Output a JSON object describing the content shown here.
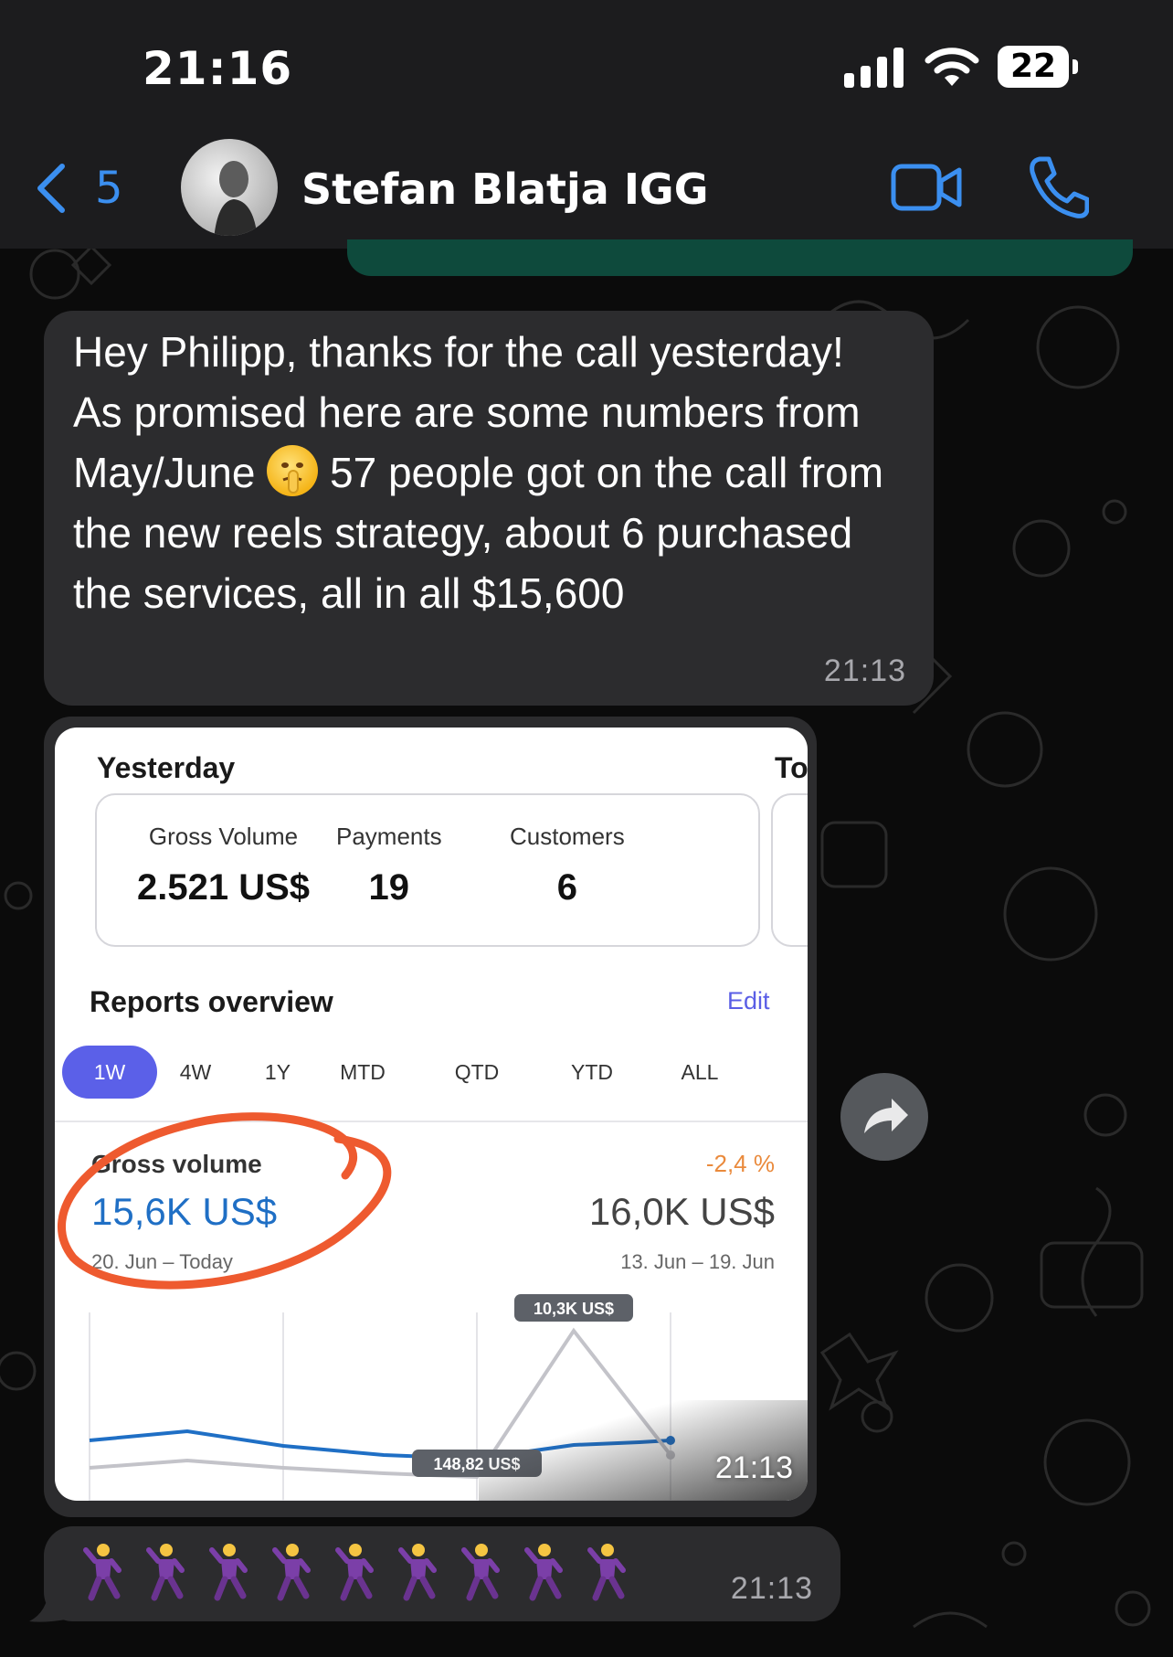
{
  "status_bar": {
    "time": "21:16",
    "battery": "22"
  },
  "header": {
    "back_count": "5",
    "contact_name": "Stefan Blatja IGG"
  },
  "messages": [
    {
      "text_parts": [
        "Hey Philipp, thanks for the call yesterday! As promised here are some numbers from May/June",
        "57 people got on the call from the new reels strategy, about 6 purchased the services, all in all $15,600"
      ],
      "inline_emoji": "shushing-face",
      "time": "21:13"
    },
    {
      "type": "image",
      "time": "21:13",
      "screenshot": {
        "yesterday_title": "Yesterday",
        "today_cut": "To",
        "stats": [
          {
            "label": "Gross Volume",
            "value": "2.521 US$"
          },
          {
            "label": "Payments",
            "value": "19"
          },
          {
            "label": "Customers",
            "value": "6"
          }
        ],
        "reports_title": "Reports overview",
        "edit_label": "Edit",
        "ranges": [
          "1W",
          "4W",
          "1Y",
          "MTD",
          "QTD",
          "YTD",
          "ALL"
        ],
        "active_range": "1W",
        "gross_volume_label": "Gross volume",
        "gross_volume_value": "15,6K US$",
        "gross_volume_range": "20. Jun – Today",
        "change": "-2,4 %",
        "previous_value": "16,0K US$",
        "previous_range": "13. Jun – 19. Jun",
        "chart_data": {
          "type": "line",
          "annotations": [
            "10,3K US$",
            "148,82 US$"
          ],
          "series": [
            {
              "values": [
                560,
                1120,
                620,
                380,
                160,
                300,
                560,
                580
              ]
            },
            {
              "values": [
                220,
                280,
                160,
                80,
                148.82,
                10300,
                320
              ]
            }
          ]
        }
      }
    },
    {
      "type": "emoji",
      "emoji": "man-dancing",
      "count": 9,
      "time": "21:13"
    }
  ],
  "colors": {
    "accent_blue": "#3b8ff0",
    "bubble_incoming": "#2c2c2e",
    "bubble_outgoing": "#0e4a3c",
    "stripe_purple": "#5b60e8",
    "gross_blue": "#1f6fc5",
    "change_orange": "#ea8a3c",
    "circle_red": "#ee5a2f"
  },
  "icons": [
    "back-chevron-icon",
    "video-call-icon",
    "phone-icon",
    "forward-icon",
    "signal-icon",
    "wifi-icon",
    "battery-icon"
  ]
}
